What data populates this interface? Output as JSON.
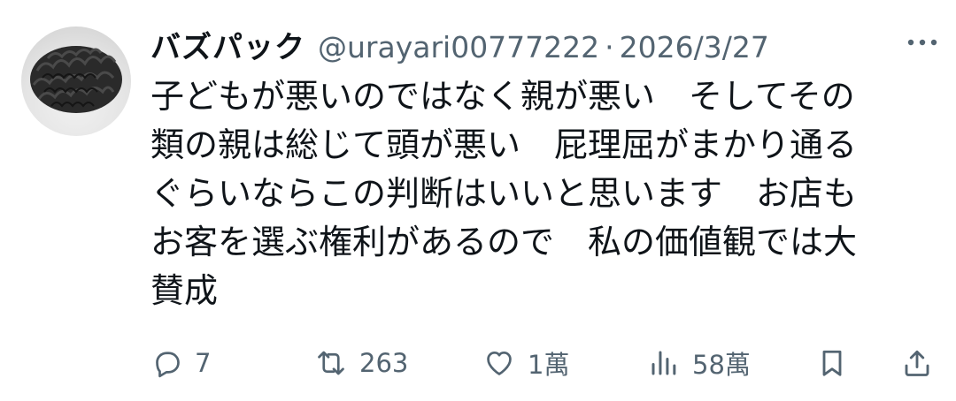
{
  "author": {
    "display_name": "バズパック",
    "handle": "@urayari00777222",
    "separator": "·",
    "date": "2026/3/27"
  },
  "tweet": {
    "lines": [
      "子どもが悪いのではなく親が悪い　そしてその",
      "類の親は総じて頭が悪い　屁理屈がまかり通る",
      "ぐらいならこの判断はいいと思います　お店も",
      "お客を選ぶ権利があるので　私の価値観では大",
      "賛成"
    ]
  },
  "actions": {
    "reply": {
      "icon": "reply-icon",
      "count": "7"
    },
    "retweet": {
      "icon": "retweet-icon",
      "count": "263"
    },
    "like": {
      "icon": "heart-icon",
      "count": "1萬"
    },
    "views": {
      "icon": "views-icon",
      "count": "58萬"
    },
    "bookmark": {
      "icon": "bookmark-icon"
    },
    "share": {
      "icon": "share-icon"
    }
  },
  "colors": {
    "text": "#0f1419",
    "secondary": "#536471",
    "background": "#ffffff"
  }
}
